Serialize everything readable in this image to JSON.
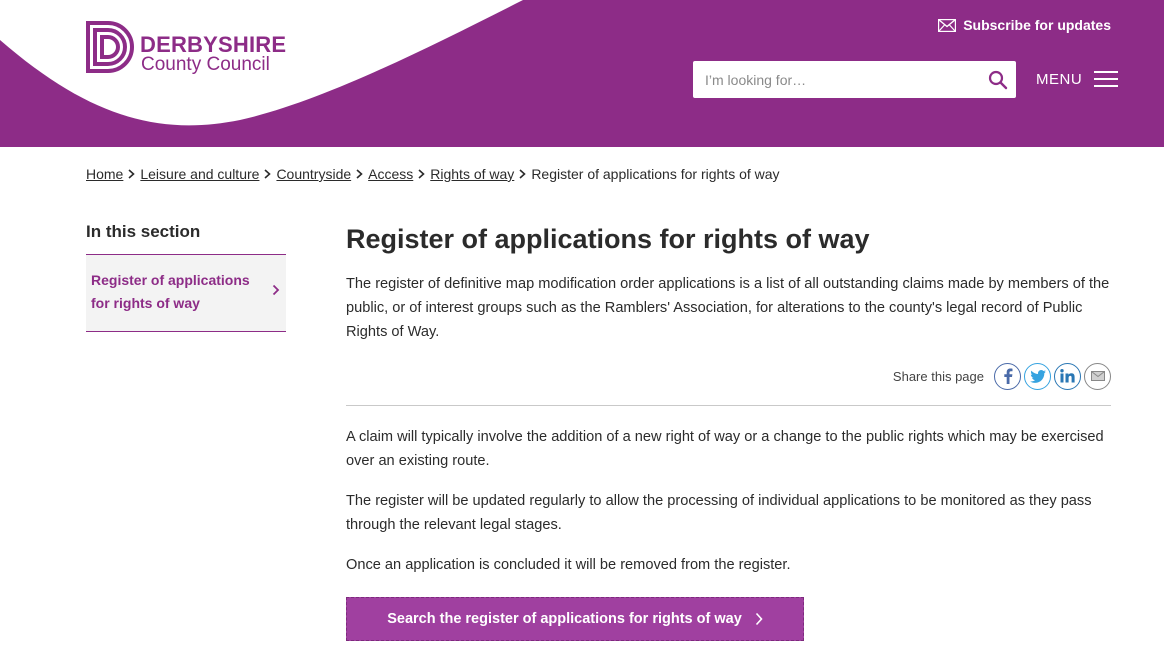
{
  "header": {
    "logo": {
      "line1": "DERBYSHIRE",
      "line2": "County Council"
    },
    "subscribe_label": "Subscribe for updates",
    "search": {
      "placeholder": "I’m looking for…",
      "value": ""
    },
    "menu_label": "MENU"
  },
  "breadcrumb": {
    "items": [
      "Home",
      "Leisure and culture",
      "Countryside",
      "Access",
      "Rights of way"
    ],
    "current": "Register of applications for rights of way"
  },
  "sidebar": {
    "title": "In this section",
    "items": [
      {
        "label": "Register of applications for rights of way"
      }
    ]
  },
  "main": {
    "title": "Register of applications for rights of way",
    "intro": "The register of definitive map modification order applications is a list of all outstanding claims made by members of the public, or of interest groups such as the Ramblers' Association, for alterations to the county's legal record of Public Rights of Way.",
    "share_label": "Share this page",
    "paragraphs": [
      "A claim will typically involve the addition of a new right of way or a change to the public rights which may be exercised over an existing route.",
      "The register will be updated regularly to allow the processing of individual applications to be monitored as they pass through the relevant legal stages.",
      "Once an application is concluded it will be removed from the register."
    ],
    "cta_label": "Search the register of applications for rights of way"
  },
  "colors": {
    "brand_purple": "#8d2c87",
    "button_purple": "#a040a0"
  }
}
